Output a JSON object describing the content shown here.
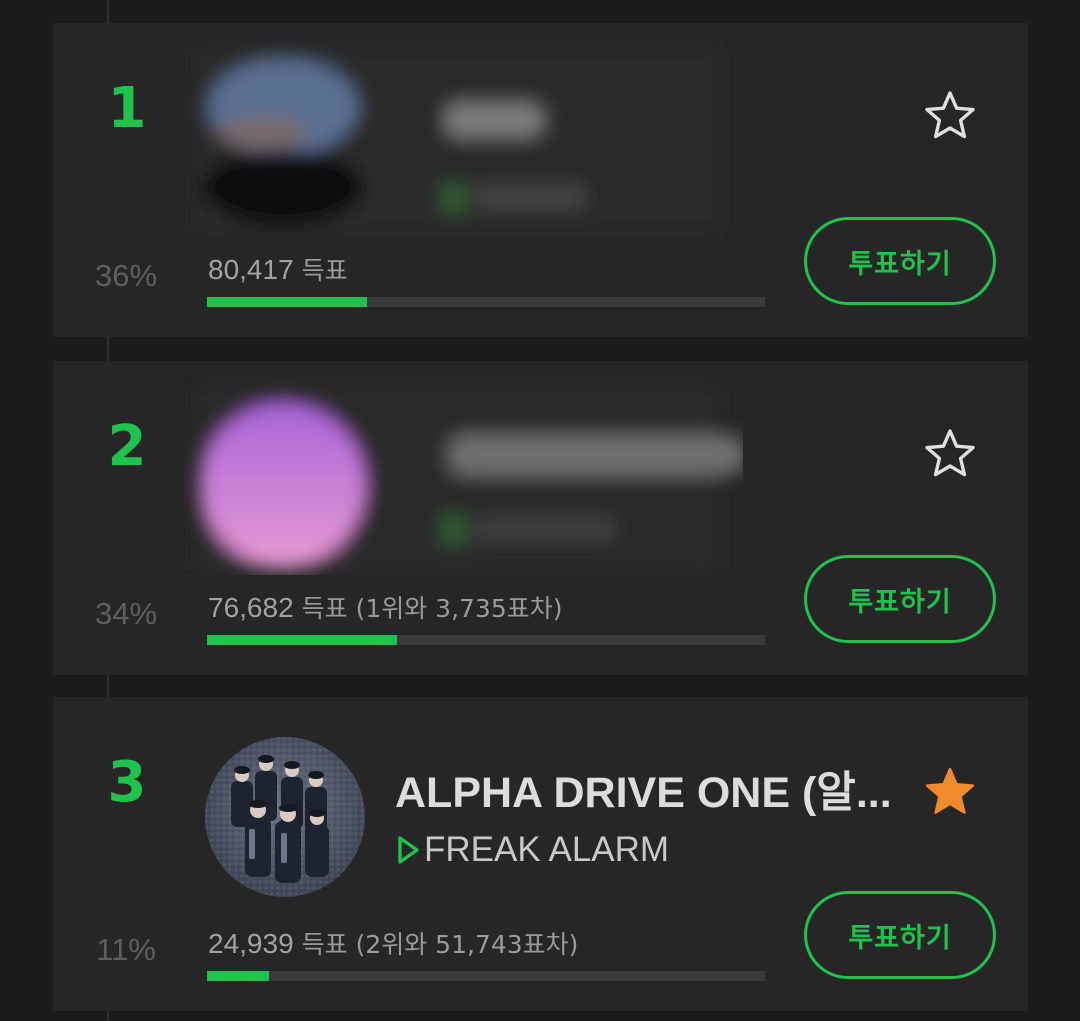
{
  "colors": {
    "background": "#1b1b1b",
    "card": "#262626",
    "accent_green": "#1fc24c",
    "star_active": "#f08b2c",
    "star_inactive": "#e0e0e0"
  },
  "entries": [
    {
      "rank": "1",
      "percent": "36%",
      "percent_value": 36,
      "votes": "80,417",
      "votes_unit": "득표",
      "votes_diff": "",
      "title": "",
      "song": "",
      "favorited": false,
      "vote_button": "투표하기",
      "redacted": true
    },
    {
      "rank": "2",
      "percent": "34%",
      "percent_value": 34,
      "votes": "76,682",
      "votes_unit": "득표",
      "votes_diff": "(1위와 3,735표차)",
      "title": "",
      "song": "",
      "favorited": false,
      "vote_button": "투표하기",
      "redacted": true
    },
    {
      "rank": "3",
      "percent": "11%",
      "percent_value": 11,
      "votes": "24,939",
      "votes_unit": "득표",
      "votes_diff": "(2위와 51,743표차)",
      "title": "ALPHA DRIVE ONE (알...",
      "song": "FREAK ALARM",
      "favorited": true,
      "vote_button": "투표하기",
      "redacted": false
    }
  ],
  "icons": {
    "star": "star-icon",
    "play": "play-icon"
  }
}
